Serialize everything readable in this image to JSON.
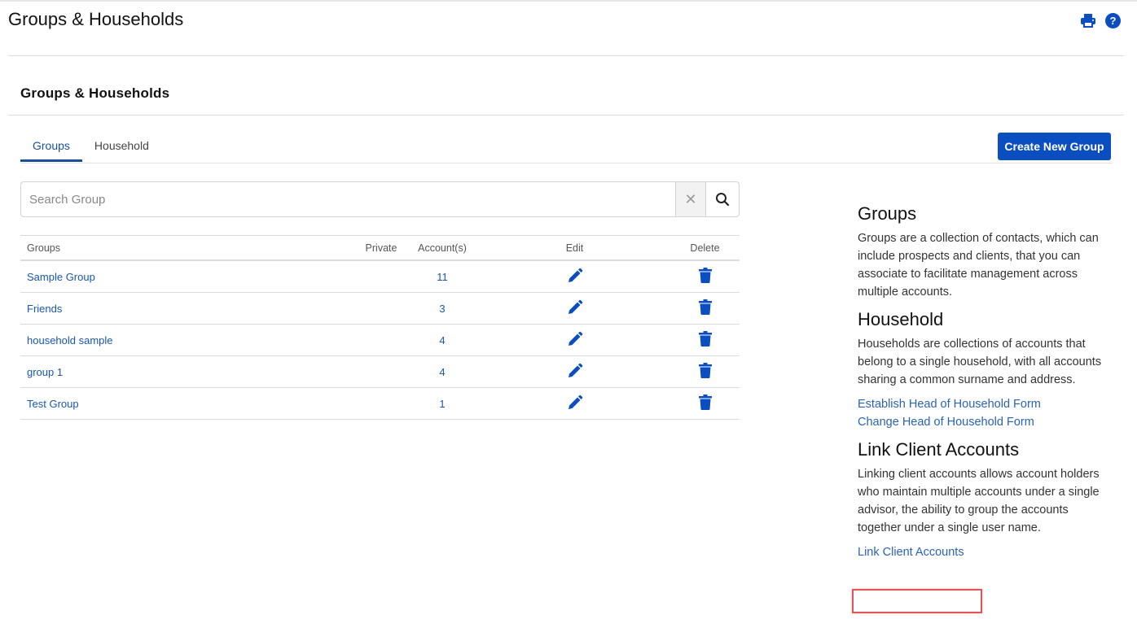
{
  "header": {
    "title": "Groups & Households",
    "icons": [
      "print-icon",
      "help-icon"
    ]
  },
  "section": {
    "title": "Groups & Households"
  },
  "tabs": [
    {
      "label": "Groups",
      "active": true
    },
    {
      "label": "Household",
      "active": false
    }
  ],
  "create_button": {
    "label": "Create New Group"
  },
  "search": {
    "placeholder": "Search Group",
    "value": ""
  },
  "table": {
    "headers": {
      "groups": "Groups",
      "private": "Private",
      "accounts": "Account(s)",
      "edit": "Edit",
      "delete": "Delete"
    },
    "rows": [
      {
        "name": "Sample Group",
        "private": "",
        "accounts": "11"
      },
      {
        "name": "Friends",
        "private": "",
        "accounts": "3"
      },
      {
        "name": "household sample",
        "private": "",
        "accounts": "4"
      },
      {
        "name": "group 1",
        "private": "",
        "accounts": "4"
      },
      {
        "name": "Test Group",
        "private": "",
        "accounts": "1"
      }
    ]
  },
  "sidebar": {
    "groups": {
      "title": "Groups",
      "text": "Groups are a collection of contacts, which can include prospects and clients, that you can associate to facilitate management across multiple accounts."
    },
    "household": {
      "title": "Household",
      "text": "Households are collections of accounts that belong to a single household, with all accounts sharing a common surname and address.",
      "links": [
        "Establish Head of Household Form",
        "Change Head of Household Form"
      ]
    },
    "link_accounts": {
      "title": "Link Client Accounts",
      "text": "Linking client accounts allows account holders who maintain multiple accounts under a single advisor, the ability to group the accounts together under a single user name.",
      "link": "Link Client Accounts"
    }
  },
  "colors": {
    "accent": "#0b4ec0",
    "link": "#1a56b0",
    "highlight": "#e05555"
  }
}
